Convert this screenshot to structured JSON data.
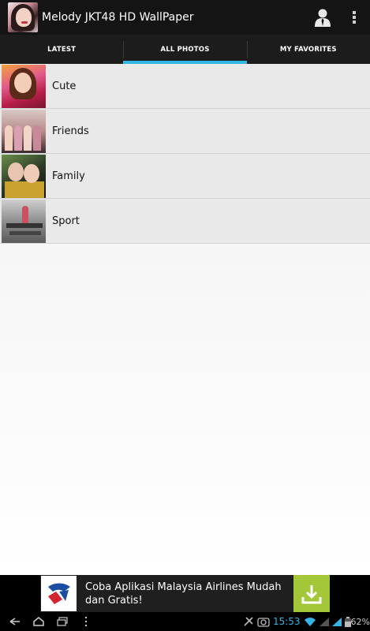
{
  "app": {
    "title": "Melody JKT48 HD WallPaper"
  },
  "actionbar": {
    "profile_icon": "person-icon",
    "overflow_icon": "overflow-menu-icon"
  },
  "tabs": [
    {
      "label": "LATEST",
      "active": false
    },
    {
      "label": "ALL PHOTOS",
      "active": true
    },
    {
      "label": "MY FAVORITES",
      "active": false
    }
  ],
  "categories": [
    {
      "label": "Cute"
    },
    {
      "label": "Friends"
    },
    {
      "label": "Family"
    },
    {
      "label": "Sport"
    }
  ],
  "ad": {
    "text": "Coba Aplikasi Malaysia Airlines Mudah dan Gratis!",
    "download_icon": "download-icon"
  },
  "statusbar": {
    "time": "15:53",
    "battery": "62%"
  },
  "colors": {
    "accent": "#33b5e5",
    "actionbar": "#141414",
    "ad_button": "#a4c639"
  }
}
